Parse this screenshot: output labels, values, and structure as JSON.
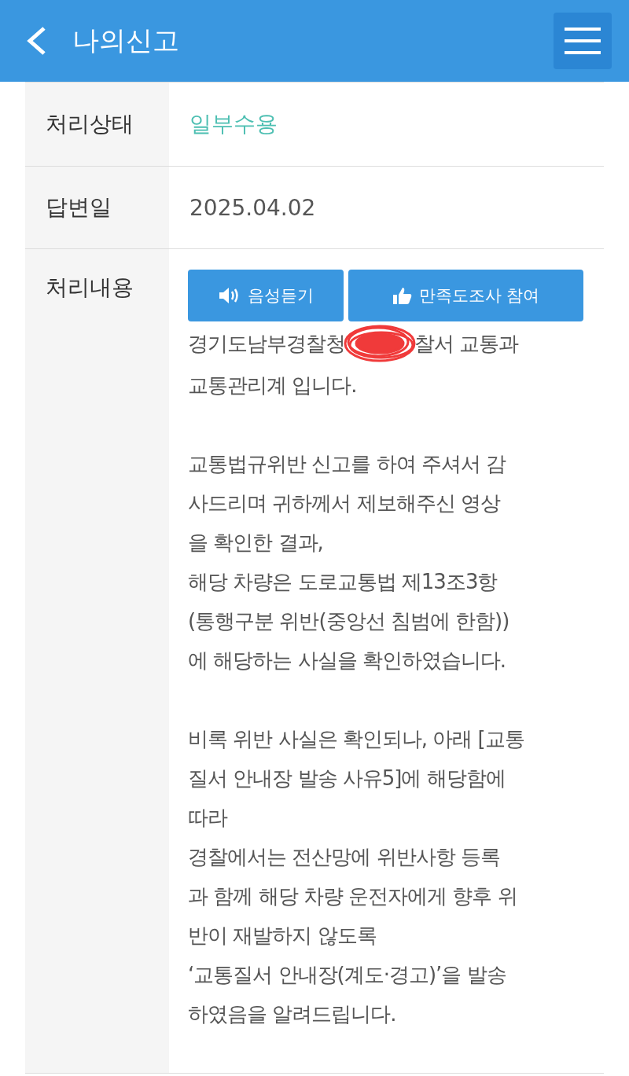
{
  "header": {
    "title": "나의신고"
  },
  "rows": [
    {
      "kind": "status",
      "label": "처리상태",
      "value": "일부수용"
    },
    {
      "kind": "text",
      "label": "답변일",
      "value": "2025.04.02"
    }
  ],
  "content": {
    "label": "처리내용",
    "buttons": [
      {
        "kind": "speaker",
        "label": "음성듣기"
      },
      {
        "kind": "thumb",
        "label": "만족도조사 참여"
      }
    ],
    "redacted_line": {
      "before": "경기도남부경찰청",
      "after": "찰서 교통과"
    },
    "paragraphs": [
      [
        "교통관리계 입니다."
      ],
      [
        "교통법규위반 신고를 하여 주셔서 감",
        "사드리며 귀하께서 제보해주신 영상",
        "을 확인한 결과,",
        "해당 차량은 도로교통법 제13조3항",
        "(통행구분 위반(중앙선 침범에 한함))",
        "에 해당하는 사실을 확인하였습니다."
      ],
      [
        "비록 위반 사실은 확인되나, 아래 [교통",
        "질서 안내장 발송 사유5]에 해당함에",
        "따라",
        "경찰에서는 전산망에 위반사항 등록",
        "과 함께 해당 차량 운전자에게 향후 위",
        "반이 재발하지 않도록",
        "‘교통질서 안내장(계도·경고)’을 발송",
        "하였음을 알려드립니다."
      ]
    ]
  }
}
